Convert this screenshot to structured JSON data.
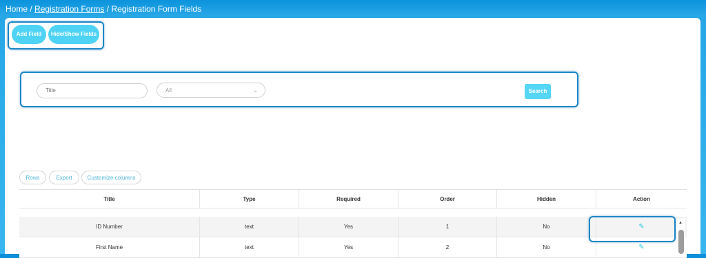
{
  "breadcrumb": {
    "home": "Home",
    "sep1": "/",
    "forms": "Registration Forms",
    "sep2": "/",
    "current": "Registration Form Fields"
  },
  "toolbar": {
    "add_field": "Add Field",
    "hide_show_fields": "Hide/Show Fields"
  },
  "filters": {
    "title_placeholder": "Title",
    "type_select_value": "All",
    "search_label": "Search"
  },
  "table_tools": {
    "rows": "Rows",
    "export": "Export",
    "customize": "Customize columns"
  },
  "table": {
    "headers": [
      "Title",
      "Type",
      "Required",
      "Order",
      "Hidden",
      "Action"
    ],
    "rows": [
      {
        "title": "ID Number",
        "type": "text",
        "required": "Yes",
        "order": "1",
        "hidden": "No"
      },
      {
        "title": "First Name",
        "type": "text",
        "required": "Yes",
        "order": "2",
        "hidden": "No"
      }
    ]
  },
  "icons": {
    "edit": "pencil-icon",
    "select_arrow": "chevron-down-icon",
    "scroll_up": "scroll-up-arrow-icon"
  },
  "colors": {
    "frame": "#0a8fd8",
    "accent": "#4fd3f5",
    "highlight": "#1a86c8"
  }
}
